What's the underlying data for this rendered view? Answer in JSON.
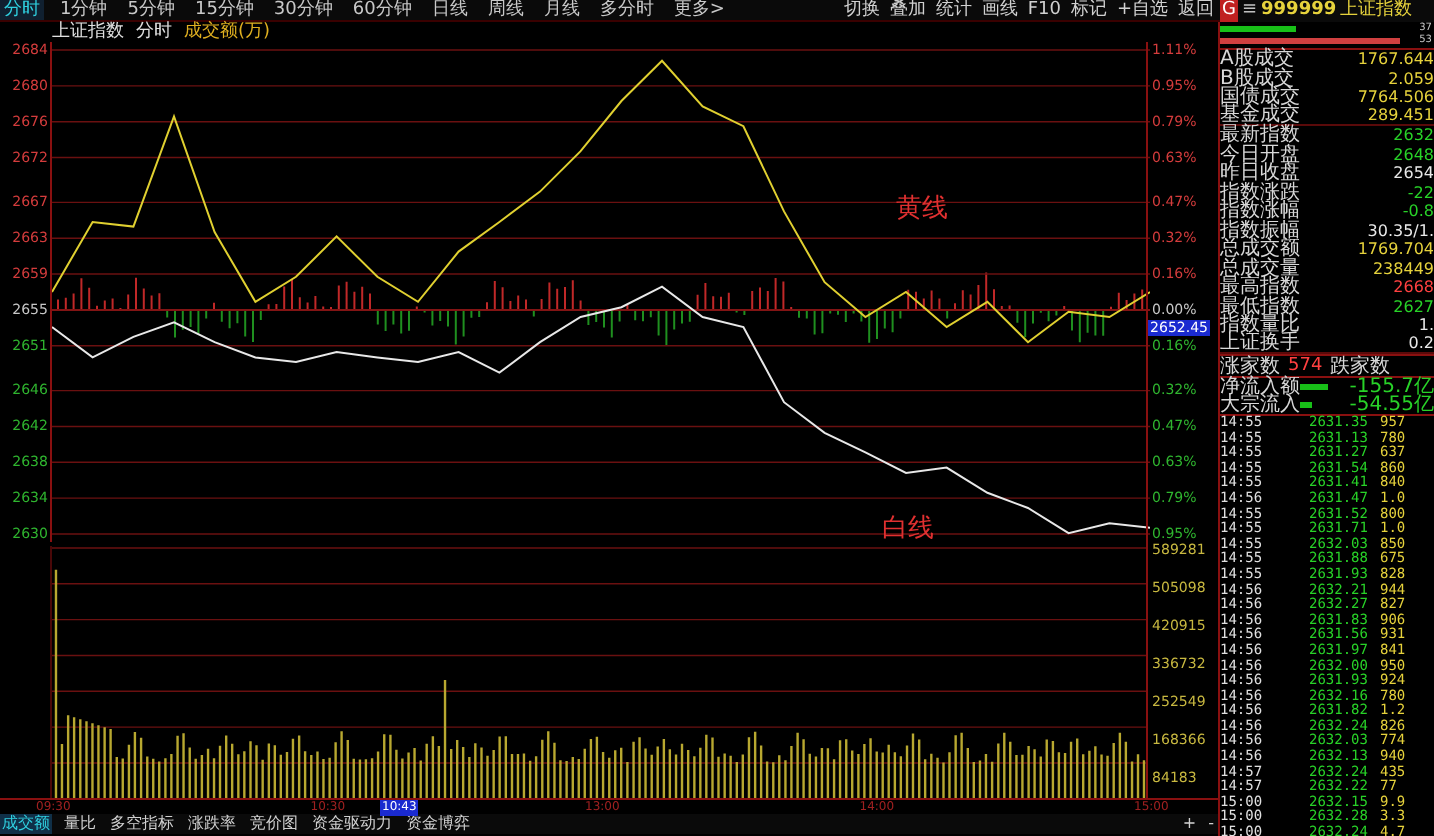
{
  "toolbar": {
    "periods": [
      {
        "label": "分时",
        "selected": true
      },
      {
        "label": "1分钟",
        "selected": false
      },
      {
        "label": "5分钟",
        "selected": false
      },
      {
        "label": "15分钟",
        "selected": false
      },
      {
        "label": "30分钟",
        "selected": false
      },
      {
        "label": "60分钟",
        "selected": false
      },
      {
        "label": "日线",
        "selected": false
      },
      {
        "label": "周线",
        "selected": false
      },
      {
        "label": "月线",
        "selected": false
      },
      {
        "label": "多分时",
        "selected": false
      },
      {
        "label": "更多>",
        "selected": false
      }
    ],
    "actions": [
      "切换",
      "叠加",
      "统计",
      "画线",
      "F10",
      "标记",
      "+自选",
      "返回"
    ]
  },
  "chart_header": {
    "name": "上证指数",
    "mode": "分时",
    "indicator": "成交额(万)"
  },
  "price_chart": {
    "chart_data": {
      "type": "line",
      "grid": true,
      "ylim": [
        2630,
        2684
      ],
      "yticks": [
        2684,
        2680,
        2676,
        2672,
        2667,
        2663,
        2659,
        2655,
        2651,
        2646,
        2642,
        2638,
        2634,
        2630
      ],
      "series": [
        {
          "name": "黄线",
          "color": "#e0d030",
          "values": [
            2657.0,
            2664.8,
            2664.3,
            2676.6,
            2663.7,
            2655.9,
            2658.7,
            2663.2,
            2658.7,
            2655.9,
            2661.5,
            2664.8,
            2668.2,
            2672.7,
            2678.3,
            2682.8,
            2677.7,
            2675.5,
            2666.0,
            2658.1,
            2654.2,
            2657.0,
            2653.1,
            2655.9,
            2651.4,
            2654.8,
            2654.2,
            2657.0
          ]
        },
        {
          "name": "白线",
          "color": "#e8e8e8",
          "values": [
            2653.1,
            2649.7,
            2652.0,
            2653.6,
            2651.4,
            2649.7,
            2649.2,
            2650.3,
            2649.7,
            2649.2,
            2650.3,
            2648.0,
            2651.4,
            2654.2,
            2655.3,
            2657.6,
            2654.2,
            2653.1,
            2644.7,
            2641.3,
            2639.1,
            2636.8,
            2637.4,
            2634.6,
            2632.9,
            2630.1,
            2631.2,
            2630.7
          ]
        }
      ]
    },
    "percent_labels": [
      {
        "label": "1.11%",
        "color": "#d43c3c"
      },
      {
        "label": "0.95%",
        "color": "#d43c3c"
      },
      {
        "label": "0.79%",
        "color": "#d43c3c"
      },
      {
        "label": "0.63%",
        "color": "#d43c3c"
      },
      {
        "label": "0.47%",
        "color": "#d43c3c"
      },
      {
        "label": "0.32%",
        "color": "#d43c3c"
      },
      {
        "label": "0.16%",
        "color": "#d43c3c"
      },
      {
        "label": "0.00%",
        "color": "#c8c8c8"
      },
      {
        "label": "0.16%",
        "color": "#2fb52f"
      },
      {
        "label": "0.32%",
        "color": "#2fb52f"
      },
      {
        "label": "0.47%",
        "color": "#2fb52f"
      },
      {
        "label": "0.63%",
        "color": "#2fb52f"
      },
      {
        "label": "0.79%",
        "color": "#2fb52f"
      },
      {
        "label": "0.95%",
        "color": "#2fb52f"
      }
    ],
    "cursor_price": "2652.45"
  },
  "time_axis": [
    "09:30",
    "10:30",
    "13:00",
    "14:00",
    "15:00"
  ],
  "volume_axis": [
    "589281",
    "505098",
    "420915",
    "336732",
    "252549",
    "168366",
    "84183"
  ],
  "cursor_time": "10:43",
  "bottom_tabs": [
    {
      "label": "成交额",
      "selected": true
    },
    {
      "label": "量比",
      "selected": false
    },
    {
      "label": "多空指标",
      "selected": false
    },
    {
      "label": "涨跌率",
      "selected": false
    },
    {
      "label": "竞价图",
      "selected": false
    },
    {
      "label": "资金驱动力",
      "selected": false
    },
    {
      "label": "资金博弈",
      "selected": false
    }
  ],
  "zoom_buttons": [
    "+",
    "-"
  ],
  "quote_panel": {
    "badge": "G",
    "menu": "≡",
    "code": "999999",
    "name": "上证指数",
    "breadth": [
      {
        "kind": "up",
        "value": "37"
      },
      {
        "kind": "down",
        "value": "53"
      }
    ],
    "rows": [
      {
        "label": "A股成交",
        "value": "1767.644",
        "color": "#e6d23c"
      },
      {
        "label": "B股成交",
        "value": "2.059",
        "color": "#e6d23c"
      },
      {
        "label": "国债成交",
        "value": "7764.506",
        "color": "#e6d23c"
      },
      {
        "label": "基金成交",
        "value": "289.451",
        "color": "#e6d23c"
      },
      {
        "label": "最新指数",
        "value": "2632",
        "color": "#28d228"
      },
      {
        "label": "今日开盘",
        "value": "2648",
        "color": "#28d228"
      },
      {
        "label": "昨日收盘",
        "value": "2654",
        "color": "#e8e8e8"
      },
      {
        "label": "指数涨跌",
        "value": "-22",
        "color": "#28d228"
      },
      {
        "label": "指数涨幅",
        "value": "-0.8",
        "color": "#28d228"
      },
      {
        "label": "指数振幅",
        "value": "30.35/1.",
        "color": "#e8e8e8"
      },
      {
        "label": "总成交额",
        "value": "1769.704",
        "color": "#e6d23c"
      },
      {
        "label": "总成交量",
        "value": "238449",
        "color": "#e6d23c"
      },
      {
        "label": "最高指数",
        "value": "2668",
        "color": "#ff4040"
      },
      {
        "label": "最低指数",
        "value": "2627",
        "color": "#28d228"
      },
      {
        "label": "指数量比",
        "value": "1.",
        "color": "#e8e8e8"
      },
      {
        "label": "上证换手",
        "value": "0.2",
        "color": "#e8e8e8"
      }
    ],
    "advancers_label": "涨家数",
    "advancers": "574",
    "decliners_label": "跌家数",
    "flows": [
      {
        "label": "净流入额",
        "value": "-155.7亿"
      },
      {
        "label": "大宗流入",
        "value": "-54.55亿"
      }
    ],
    "ticks": [
      [
        "14:55",
        "2631.35",
        "957"
      ],
      [
        "14:55",
        "2631.13",
        "780"
      ],
      [
        "14:55",
        "2631.27",
        "637"
      ],
      [
        "14:55",
        "2631.54",
        "860"
      ],
      [
        "14:55",
        "2631.41",
        "840"
      ],
      [
        "14:56",
        "2631.47",
        "1.0"
      ],
      [
        "14:55",
        "2631.52",
        "800"
      ],
      [
        "14:55",
        "2631.71",
        "1.0"
      ],
      [
        "14:55",
        "2632.03",
        "850"
      ],
      [
        "14:55",
        "2631.88",
        "675"
      ],
      [
        "14:55",
        "2631.93",
        "828"
      ],
      [
        "14:56",
        "2632.21",
        "944"
      ],
      [
        "14:56",
        "2632.27",
        "827"
      ],
      [
        "14:56",
        "2631.83",
        "906"
      ],
      [
        "14:56",
        "2631.56",
        "931"
      ],
      [
        "14:56",
        "2631.97",
        "841"
      ],
      [
        "14:56",
        "2632.00",
        "950"
      ],
      [
        "14:56",
        "2631.93",
        "924"
      ],
      [
        "14:56",
        "2632.16",
        "780"
      ],
      [
        "14:56",
        "2631.82",
        "1.2"
      ],
      [
        "14:56",
        "2632.24",
        "826"
      ],
      [
        "14:56",
        "2632.03",
        "774"
      ],
      [
        "14:56",
        "2632.13",
        "940"
      ],
      [
        "14:57",
        "2632.24",
        "435"
      ],
      [
        "14:57",
        "2632.22",
        "77"
      ],
      [
        "15:00",
        "2632.15",
        "9.9"
      ],
      [
        "15:00",
        "2632.28",
        "3.3"
      ],
      [
        "15:00",
        "2632.24",
        "4.7"
      ]
    ]
  }
}
